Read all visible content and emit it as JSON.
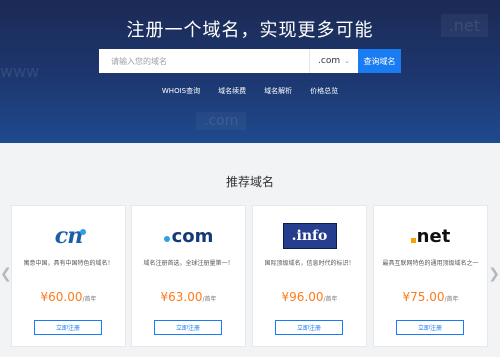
{
  "hero": {
    "title": "注册一个域名，实现更多可能",
    "background_texts": {
      "net": ".net",
      "www": "www",
      "com": ".com"
    },
    "search": {
      "placeholder": "请输入您的域名",
      "tld_selected": ".com",
      "button_label": "查询域名"
    },
    "links": [
      "WHOIS查询",
      "域名续费",
      "域名解析",
      "价格总览"
    ]
  },
  "section": {
    "title": "推荐域名"
  },
  "cards": [
    {
      "logo_text": "cn",
      "desc": "寓意中国，具有中国特色的域名！",
      "price": "¥60.00",
      "unit": "/首年",
      "button_label": "立即注册"
    },
    {
      "logo_text": "com",
      "desc": "域名注册首选，全球注册量第一！",
      "price": "¥63.00",
      "unit": "/首年",
      "button_label": "立即注册"
    },
    {
      "logo_text": "info",
      "desc": "国际顶级域名，信息时代的标识！",
      "price": "¥96.00",
      "unit": "/首年",
      "button_label": "立即注册"
    },
    {
      "logo_text": "net",
      "desc": "最具互联网特色的通用顶级域名之一",
      "price": "¥75.00",
      "unit": "/首年",
      "button_label": "立即注册"
    }
  ],
  "colors": {
    "accent": "#1a7cf2",
    "price": "#ff7b1c",
    "hero_bg": "#1d3770"
  },
  "icons": {
    "carousel_prev": "chevron-left-icon",
    "carousel_next": "chevron-right-icon",
    "tld_dropdown": "chevron-down-icon"
  }
}
